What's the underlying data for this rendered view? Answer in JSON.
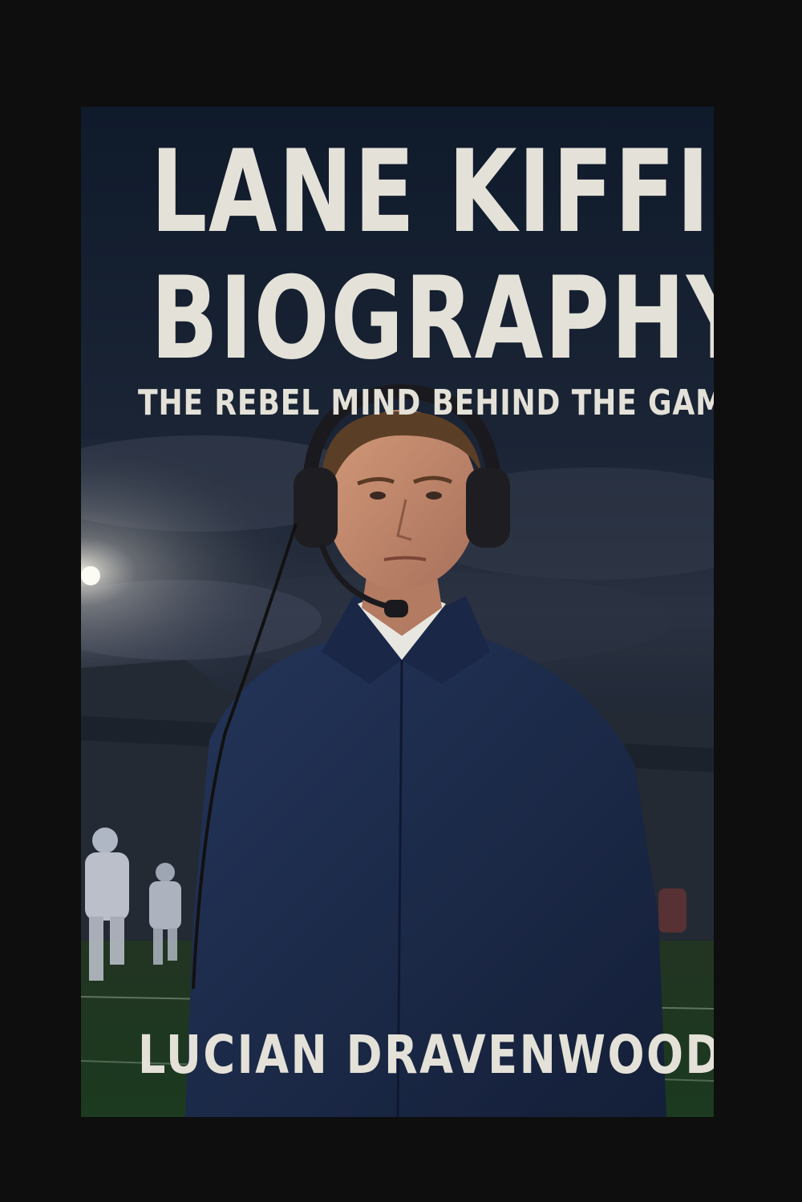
{
  "book": {
    "title_line_1": "LANE KIFFIN",
    "title_line_2": "BIOGRAPHY",
    "subtitle": "THE REBEL MIND BEHIND THE GAME",
    "author": "LUCIAN DRAVENWOOD"
  },
  "colors": {
    "background": "#0e0e0e",
    "sky": "#1b2536",
    "text": "#e4e1d8",
    "jacket": "#1c2a4a",
    "field": "#1f3b22"
  }
}
